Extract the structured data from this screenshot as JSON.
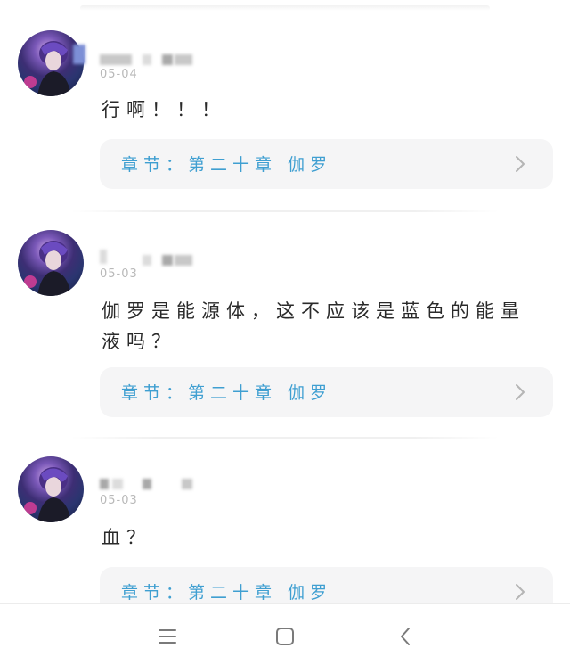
{
  "comments": [
    {
      "date": "05-04",
      "text": "行啊！！！",
      "chapter_label": "章节：第二十章 伽罗"
    },
    {
      "date": "05-03",
      "text": "伽罗是能源体，这不应该是蓝色的能量液吗？",
      "chapter_label": "章节：第二十章 伽罗"
    },
    {
      "date": "05-03",
      "text": "血？",
      "chapter_label": "章节：第二十章 伽罗"
    }
  ],
  "nav": {
    "menu_icon": "menu-icon",
    "home_icon": "home-square-icon",
    "back_icon": "back-chevron-icon"
  },
  "colors": {
    "chapter_link": "#3f9fd1",
    "card_bg": "#f5f5f6",
    "date": "#b9b9b9"
  }
}
